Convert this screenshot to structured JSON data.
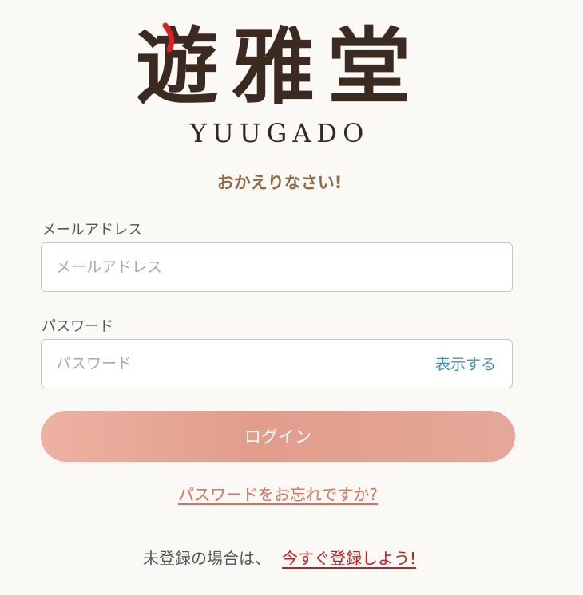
{
  "logo": {
    "kanji": "遊雅堂",
    "roman": "YUUGADO",
    "accent_color": "#e02020"
  },
  "welcome": "おかえりなさい!",
  "email": {
    "label": "メールアドレス",
    "placeholder": "メールアドレス",
    "value": ""
  },
  "password": {
    "label": "パスワード",
    "placeholder": "パスワード",
    "value": "",
    "show_label": "表示する"
  },
  "login_button": "ログイン",
  "forgot_link": "パスワードをお忘れですか?",
  "signup": {
    "prompt": "未登録の場合は、",
    "link": "今すぐ登録しよう!"
  },
  "colors": {
    "background": "#fbf9f6",
    "title": "#8e6b45",
    "button": "#e19d8c",
    "forgot_link": "#de6f58",
    "signup_link": "#c41e1e",
    "show_toggle": "#3b93c6"
  }
}
